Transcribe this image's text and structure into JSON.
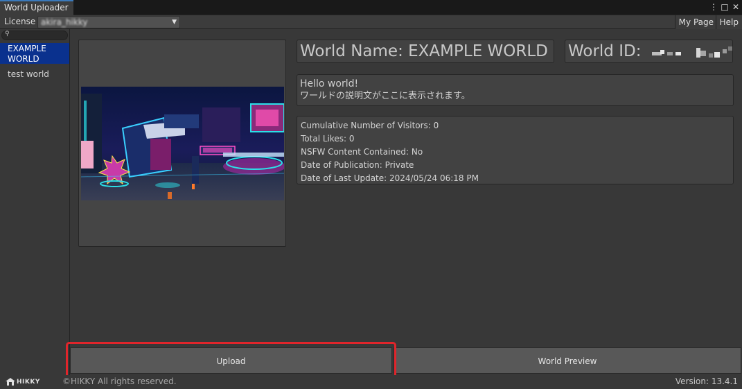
{
  "window": {
    "tab_title": "World Uploader",
    "controls": [
      "⋮",
      "□",
      "✕"
    ]
  },
  "toolbar": {
    "license_label": "License",
    "license_value": "akira_hikky",
    "my_page_label": "My Page",
    "help_label": "Help"
  },
  "sidebar": {
    "search_placeholder": "",
    "items": [
      {
        "label": "EXAMPLE WORLD",
        "selected": true
      },
      {
        "label": "test world",
        "selected": false
      }
    ]
  },
  "world": {
    "name_text": "World Name: EXAMPLE WORLD",
    "id_label": "World ID:",
    "description_line1": "Hello world!",
    "description_line2": "ワールドの説明文がここに表示されます。",
    "stats": [
      "Cumulative Number of Visitors: 0",
      "Total Likes: 0",
      "NSFW Content Contained: No",
      "Date of Publication: Private",
      "Date of Last Update: 2024/05/24 06:18 PM"
    ]
  },
  "actions": {
    "upload_label": "Upload",
    "preview_label": "World Preview"
  },
  "footer": {
    "logo_text": "HIKKY",
    "copyright": "©HIKKY All rights reserved.",
    "version": "Version: 13.4.1"
  },
  "colors": {
    "selected_item_bg": "#0a318e",
    "highlight": "#e0252b",
    "tab_accent": "#3a79bb"
  }
}
